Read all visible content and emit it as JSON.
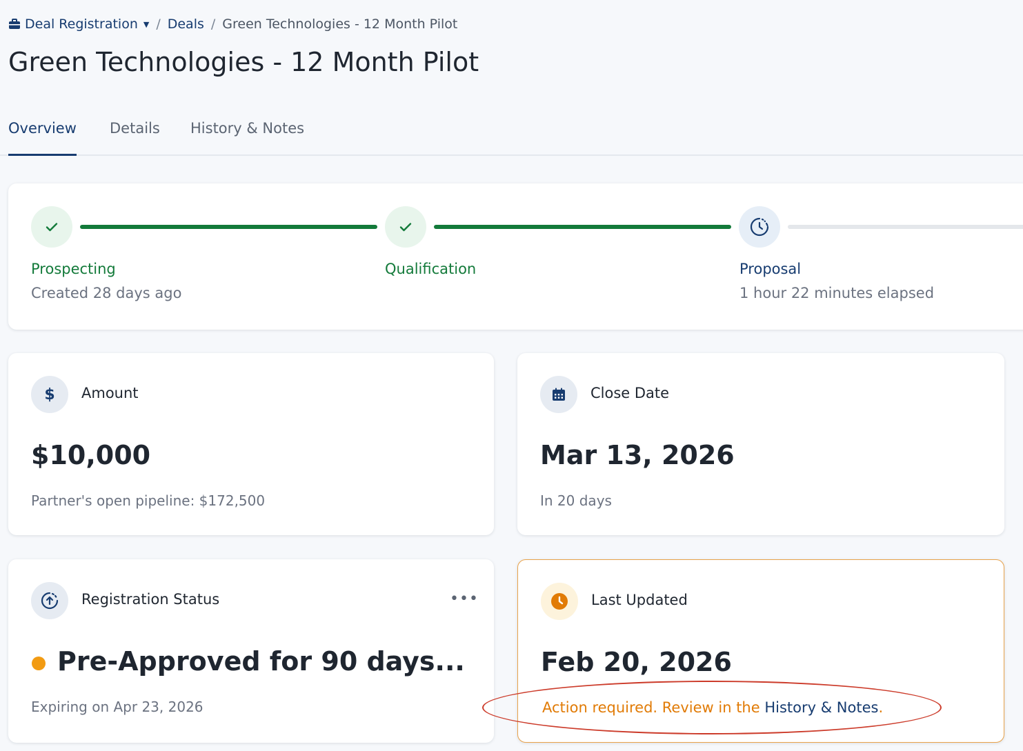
{
  "breadcrumb": {
    "root": "Deal Registration",
    "deals": "Deals",
    "current": "Green Technologies - 12 Month Pilot"
  },
  "title": "Green Technologies - 12 Month Pilot",
  "tabs": [
    {
      "label": "Overview",
      "active": true
    },
    {
      "label": "Details",
      "active": false
    },
    {
      "label": "History & Notes",
      "active": false
    }
  ],
  "stages": [
    {
      "label": "Prospecting",
      "sub": "Created 28 days ago",
      "state": "done"
    },
    {
      "label": "Qualification",
      "sub": "",
      "state": "done"
    },
    {
      "label": "Proposal",
      "sub": "1 hour 22 minutes elapsed",
      "state": "current"
    }
  ],
  "amount": {
    "label": "Amount",
    "value": "$10,000",
    "sub": "Partner's open pipeline: $172,500",
    "icon": "dollar-icon"
  },
  "close_date": {
    "label": "Close Date",
    "value": "Mar 13, 2026",
    "sub": "In 20 days",
    "icon": "calendar-icon"
  },
  "registration": {
    "label": "Registration Status",
    "value": "Pre-Approved for 90 days...",
    "sub": "Expiring on Apr 23, 2026",
    "more": "•••",
    "icon": "upload-cycle-icon",
    "status_color": "#f29b12"
  },
  "last_updated": {
    "label": "Last Updated",
    "value": "Feb 20, 2026",
    "action_text": "Action required. Review in the ",
    "action_link": "History & Notes",
    "action_end": ".",
    "icon": "clock-icon",
    "accent": "#e17b06"
  },
  "colors": {
    "primary": "#173c70",
    "success": "#137a3a",
    "warning": "#e17b06",
    "annotation": "#cc3b2a"
  }
}
